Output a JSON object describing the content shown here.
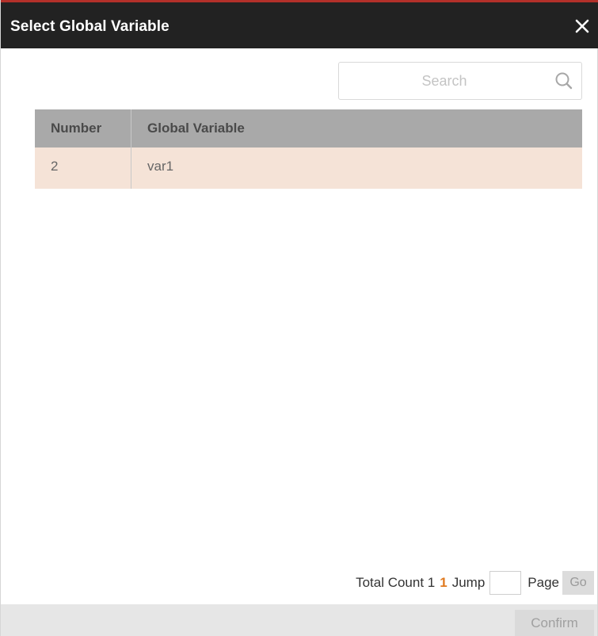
{
  "dialog": {
    "title": "Select Global Variable",
    "close_icon": "close-icon"
  },
  "search": {
    "placeholder": "Search",
    "value": "",
    "icon": "search-icon"
  },
  "table": {
    "columns": [
      "Number",
      "Global Variable"
    ],
    "rows": [
      {
        "number": "2",
        "variable": "var1"
      }
    ]
  },
  "pagination": {
    "total_label": "Total Count 1",
    "current_page": "1",
    "jump_label": "Jump",
    "jump_value": "",
    "page_label": "Page",
    "go_label": "Go"
  },
  "footer": {
    "confirm_label": "Confirm"
  },
  "colors": {
    "title_bar": "#222222",
    "accent_border": "#b3302a",
    "header_bg": "#a9a9a9",
    "selected_row_bg": "#f5e3d7",
    "current_page": "#e07a1f"
  }
}
